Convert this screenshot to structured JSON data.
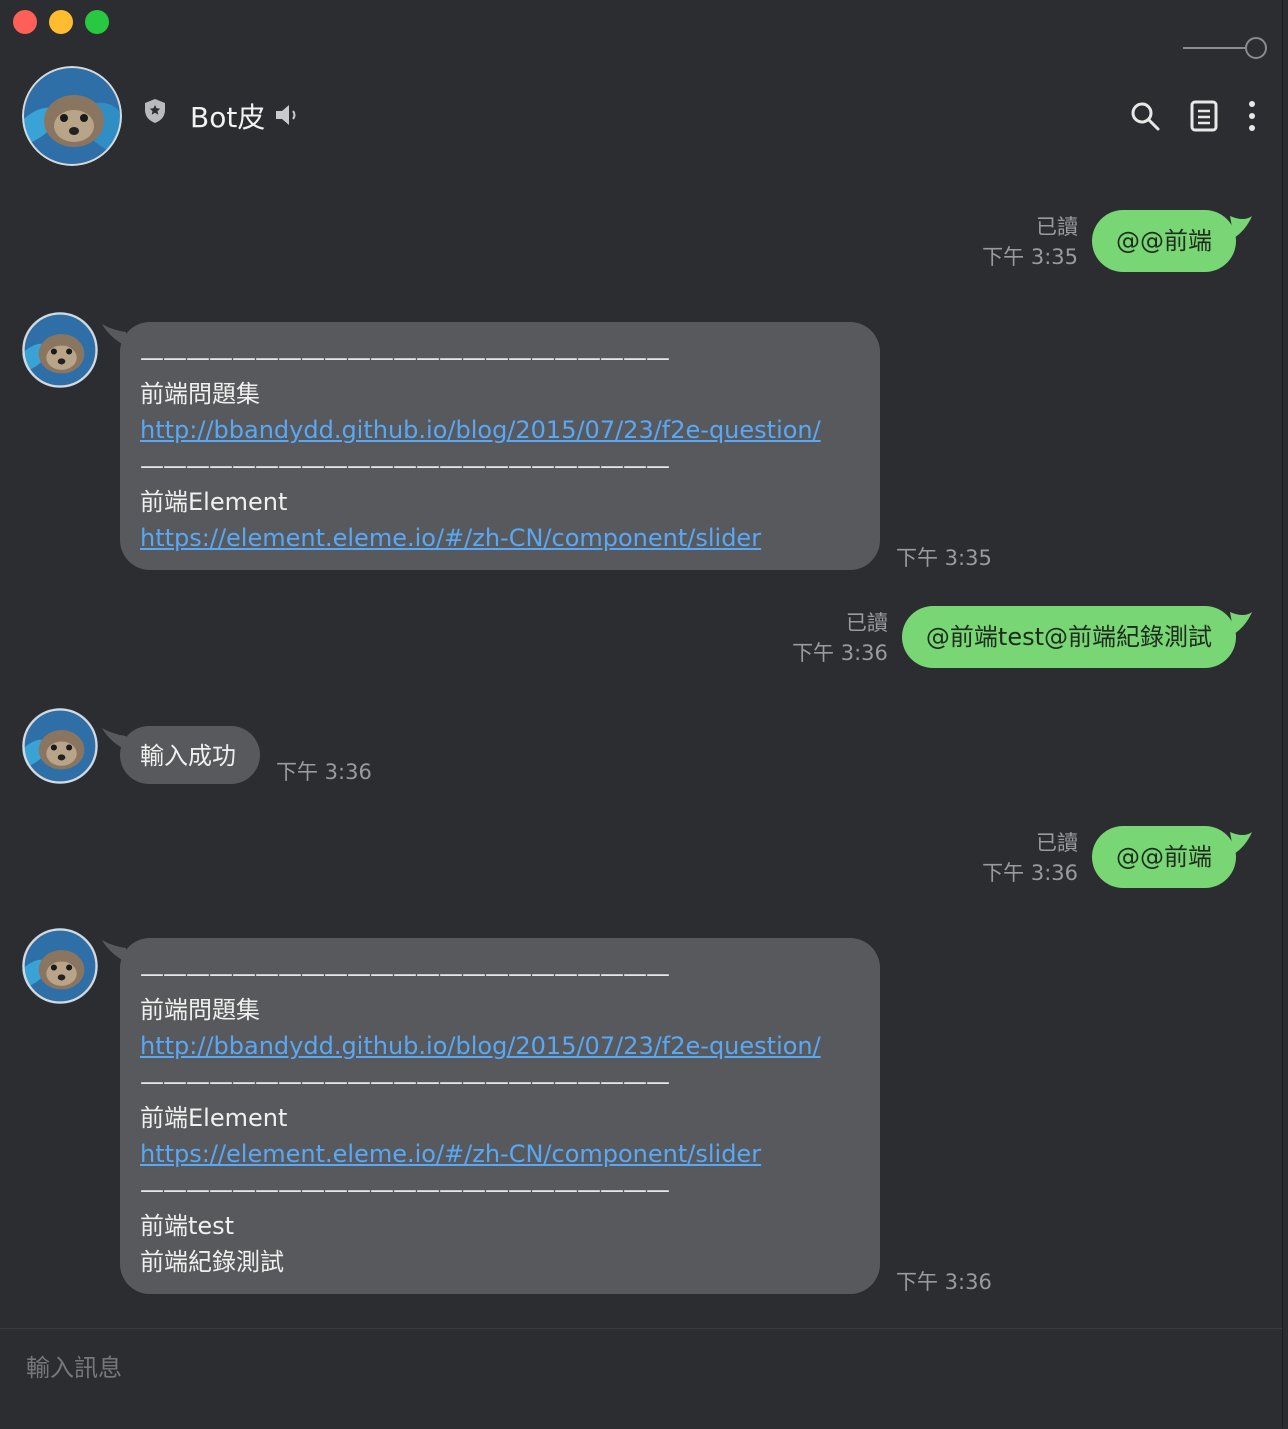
{
  "window": {
    "traffic_lights": [
      "close",
      "minimize",
      "zoom"
    ]
  },
  "header": {
    "title": "Bot皮",
    "icons": [
      "shield-icon",
      "speaker-icon",
      "search-icon",
      "notes-icon",
      "more-icon"
    ]
  },
  "messages": [
    {
      "id": "m1",
      "dir": "out",
      "read": "已讀",
      "time": "下午 3:35",
      "text": "@@前端"
    },
    {
      "id": "m2",
      "dir": "in",
      "time": "下午 3:35",
      "lines": [
        {
          "t": "dash",
          "text": "———————————————————————"
        },
        {
          "t": "text",
          "text": "前端問題集"
        },
        {
          "t": "link",
          "text": "http://bbandydd.github.io/blog/2015/07/23/f2e-question/"
        },
        {
          "t": "dash",
          "text": "———————————————————————"
        },
        {
          "t": "text",
          "text": "前端Element"
        },
        {
          "t": "link",
          "text": "https://element.eleme.io/#/zh-CN/component/slider"
        }
      ]
    },
    {
      "id": "m3",
      "dir": "out",
      "read": "已讀",
      "time": "下午 3:36",
      "text": "@前端test@前端紀錄測試"
    },
    {
      "id": "m4",
      "dir": "in",
      "time": "下午 3:36",
      "lines": [
        {
          "t": "text",
          "text": "輸入成功"
        }
      ]
    },
    {
      "id": "m5",
      "dir": "out",
      "read": "已讀",
      "time": "下午 3:36",
      "text": "@@前端"
    },
    {
      "id": "m6",
      "dir": "in",
      "time": "下午 3:36",
      "lines": [
        {
          "t": "dash",
          "text": "———————————————————————"
        },
        {
          "t": "text",
          "text": "前端問題集"
        },
        {
          "t": "link",
          "text": "http://bbandydd.github.io/blog/2015/07/23/f2e-question/"
        },
        {
          "t": "dash",
          "text": "———————————————————————"
        },
        {
          "t": "text",
          "text": "前端Element"
        },
        {
          "t": "link",
          "text": "https://element.eleme.io/#/zh-CN/component/slider"
        },
        {
          "t": "dash",
          "text": "———————————————————————"
        },
        {
          "t": "text",
          "text": "前端test"
        },
        {
          "t": "text",
          "text": "前端紀錄測試"
        }
      ]
    }
  ],
  "composer": {
    "placeholder": "輸入訊息"
  },
  "colors": {
    "background": "#2c2d30",
    "outgoing_bubble": "#78d674",
    "incoming_bubble": "#58595c",
    "link": "#59a8f5"
  }
}
